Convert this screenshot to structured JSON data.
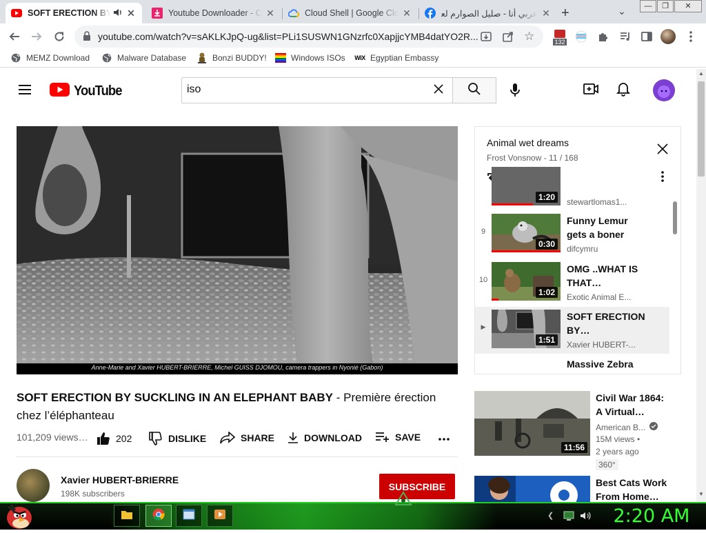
{
  "browser": {
    "tabs": [
      {
        "title": "SOFT ERECTION BY SUCKLING IN AN ELEPHANT BABY",
        "icon": "youtube-icon",
        "active": true,
        "audio": true
      },
      {
        "title": "Youtube Downloader - Convert",
        "icon": "download-icon",
        "active": false
      },
      {
        "title": "Cloud Shell | Google Cloud",
        "icon": "google-cloud-icon",
        "active": false
      },
      {
        "title": "عربي أنا - صليل الصوارم لعبة",
        "icon": "facebook-icon",
        "active": false
      }
    ],
    "new_tab_label": "+",
    "url": "youtube.com/watch?v=sAKLKJpQ-ug&list=PLi1SUSWN1GNzrfc0XapjjcYMB4datYO2R...",
    "extension_badge": "132",
    "bookmarks": [
      {
        "label": "MEMZ Download",
        "icon": "globe-icon"
      },
      {
        "label": "Malware Database",
        "icon": "globe-icon"
      },
      {
        "label": "Bonzi BUDDY!",
        "icon": "bonzi-icon"
      },
      {
        "label": "Windows ISOs",
        "icon": "rainbow-flag-icon"
      },
      {
        "label": "Egyptian Embassy",
        "icon": "wix-icon"
      }
    ]
  },
  "youtube": {
    "logo_text": "YouTube",
    "search_value": "iso",
    "video": {
      "caption": "Anne-Marie and Xavier HUBERT-BRIERRE, Michel GUISS DJOMOU, camera trappers in Nyonié (Gabon)",
      "title_bold": "SOFT ERECTION BY SUCKLING IN AN ELEPHANT BABY",
      "title_rest": " - Première érection chez l’éléphanteau",
      "views": "101,209 views…",
      "likes": "202",
      "dislike_label": "DISLIKE",
      "share_label": "SHARE",
      "download_label": "DOWNLOAD",
      "save_label": "SAVE"
    },
    "channel": {
      "name": "Xavier HUBERT-BRIERRE",
      "subscribers": "198K subscribers",
      "subscribe_label": "SUBSCRIBE"
    },
    "playlist": {
      "title": "Animal wet dreams",
      "subtitle": "Frost Vonsnow - 11 / 168",
      "items": [
        {
          "index": "",
          "duration": "1:20",
          "title": "",
          "channel": "stewartlomas1...",
          "progress": 0.6
        },
        {
          "index": "9",
          "duration": "0:30",
          "title": "Funny Lemur gets a boner",
          "channel": "difcymru",
          "progress": 1.0
        },
        {
          "index": "10",
          "duration": "1:02",
          "title": "OMG ..WHAT IS THAT…",
          "channel": "Exotic Animal E...",
          "progress": 0.1
        },
        {
          "index": "▶",
          "duration": "1:51",
          "title": "SOFT ERECTION BY…",
          "channel": "Xavier HUBERT-...",
          "progress": 0.0
        },
        {
          "index": "",
          "duration": "",
          "title": "Massive Zebra",
          "channel": "",
          "progress": 0.0
        }
      ]
    },
    "recommendations": [
      {
        "title": "Civil War 1864: A Virtual…",
        "channel": "American B...",
        "views": "15M views •",
        "age": "2 years ago",
        "badge": "360°",
        "duration": "11:56",
        "verified": true
      },
      {
        "title": "Best Cats Work From Home…",
        "channel": "",
        "views": "",
        "age": "",
        "badge": "",
        "duration": "",
        "verified": false
      }
    ]
  },
  "taskbar": {
    "clock": "2:20 AM"
  },
  "colors": {
    "youtube_red": "#ff0000",
    "subscribe_red": "#cc0000",
    "taskbar_green": "#33ff33"
  }
}
